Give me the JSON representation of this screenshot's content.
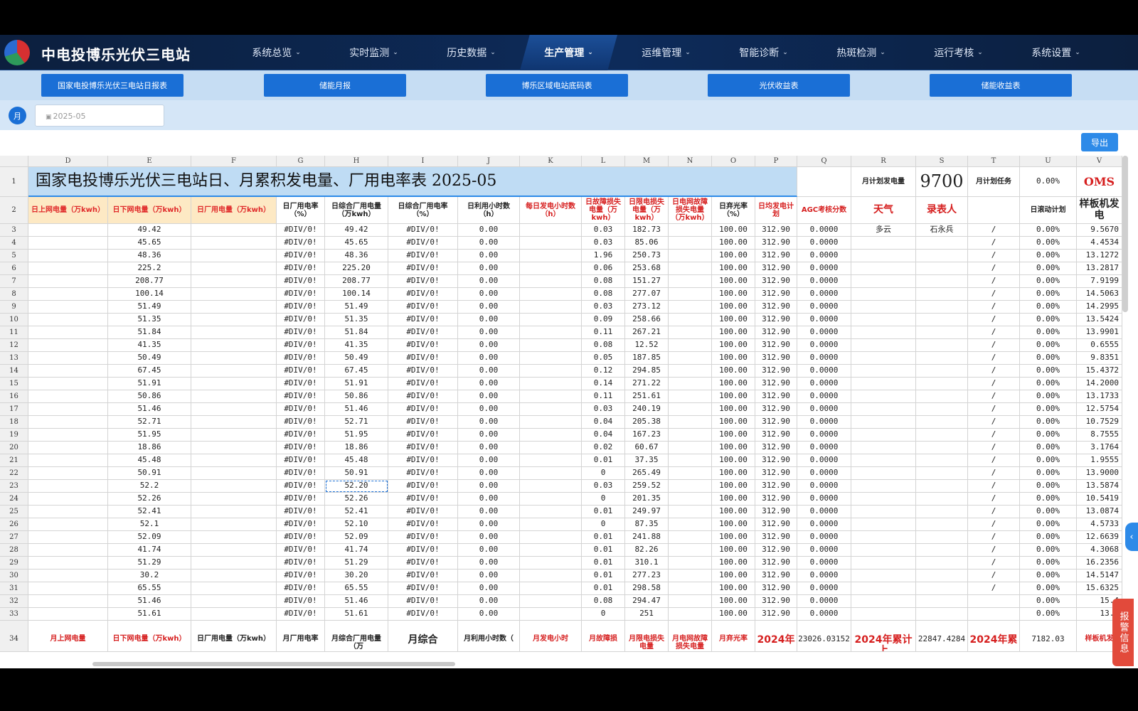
{
  "app": {
    "title": "中电投博乐光伏三电站"
  },
  "nav": {
    "items": [
      "系统总览",
      "实时监测",
      "历史数据",
      "生产管理",
      "运维管理",
      "智能诊断",
      "热斑检测",
      "运行考核",
      "系统设置"
    ],
    "active": "生产管理"
  },
  "report_tabs": [
    "国家电投博乐光伏三电站日报表",
    "储能月报",
    "博乐区域电站底码表",
    "光伏收益表",
    "储能收益表"
  ],
  "filter": {
    "month_badge": "月",
    "date_value": "2025-05"
  },
  "toolbar": {
    "export_label": "导出"
  },
  "sheet": {
    "columns": [
      "D",
      "E",
      "F",
      "G",
      "H",
      "I",
      "J",
      "K",
      "L",
      "M",
      "N",
      "O",
      "P",
      "Q",
      "R",
      "S",
      "T",
      "U",
      "V"
    ],
    "title": "国家电投博乐光伏三电站日、月累积发电量、厂用电率表 2025-05",
    "row1_right": {
      "label_r": "月计划发电量",
      "value_s": "9700",
      "label_t": "月计划任务",
      "value_u": "0.00%",
      "value_v": "OMS"
    },
    "header_row": [
      "日上网电量（万kwh）",
      "日下网电量（万kwh）",
      "日厂用电量（万kwh）",
      "日厂用电率（%）",
      "日综合厂用电量（万kwh）",
      "日综合厂用电率（%）",
      "日利用小时数（h）",
      "每日发电小时数（h）",
      "日故障损失电量（万kwh）",
      "日限电损失电量（万kwh）",
      "日电网故障损失电量（万kwh）",
      "日弃光率（%）",
      "日均发电计划",
      "AGC考核分数",
      "天气",
      "录表人",
      "",
      "日滚动计划",
      "样板机发电"
    ],
    "row_numbers": [
      "3",
      "4",
      "5",
      "6",
      "7",
      "8",
      "9",
      "10",
      "11",
      "12",
      "13",
      "14",
      "15",
      "16",
      "17",
      "18",
      "19",
      "20",
      "21",
      "22",
      "23",
      "24",
      "25",
      "26",
      "27",
      "28",
      "29",
      "30",
      "31",
      "32",
      "33"
    ],
    "col_E": [
      "49.42",
      "45.65",
      "48.36",
      "225.2",
      "208.77",
      "100.14",
      "51.49",
      "51.35",
      "51.84",
      "41.35",
      "50.49",
      "67.45",
      "51.91",
      "50.86",
      "51.46",
      "52.71",
      "51.95",
      "18.86",
      "45.48",
      "50.91",
      "52.2",
      "52.26",
      "52.41",
      "52.1",
      "52.09",
      "41.74",
      "51.29",
      "30.2",
      "65.55",
      "51.46",
      "51.61"
    ],
    "col_H": [
      "49.42",
      "45.65",
      "48.36",
      "225.20",
      "208.77",
      "100.14",
      "51.49",
      "51.35",
      "51.84",
      "41.35",
      "50.49",
      "67.45",
      "51.91",
      "50.86",
      "51.46",
      "52.71",
      "51.95",
      "18.86",
      "45.48",
      "50.91",
      "52.20",
      "52.26",
      "52.41",
      "52.10",
      "52.09",
      "41.74",
      "51.29",
      "30.20",
      "65.55",
      "51.46",
      "51.61"
    ],
    "col_L": [
      "0.03",
      "0.03",
      "1.96",
      "0.06",
      "0.08",
      "0.08",
      "0.03",
      "0.09",
      "0.11",
      "0.08",
      "0.05",
      "0.12",
      "0.14",
      "0.11",
      "0.03",
      "0.04",
      "0.04",
      "0.02",
      "0.01",
      "0",
      "0.03",
      "0",
      "0.01",
      "0",
      "0.01",
      "0.01",
      "0.01",
      "0.01",
      "0.01",
      "0.08",
      "0"
    ],
    "col_M": [
      "182.73",
      "85.06",
      "250.73",
      "253.68",
      "151.27",
      "277.07",
      "273.12",
      "258.66",
      "267.21",
      "12.52",
      "187.85",
      "294.85",
      "271.22",
      "251.61",
      "240.19",
      "205.38",
      "167.23",
      "60.67",
      "37.35",
      "265.49",
      "259.52",
      "201.35",
      "249.97",
      "87.35",
      "241.88",
      "82.26",
      "310.1",
      "277.23",
      "298.58",
      "294.47",
      "251"
    ],
    "col_V": [
      "9.5670",
      "4.4534",
      "13.1272",
      "13.2817",
      "7.9199",
      "14.5063",
      "14.2995",
      "13.5424",
      "13.9901",
      "0.6555",
      "9.8351",
      "15.4372",
      "14.2000",
      "13.1733",
      "12.5754",
      "10.7529",
      "8.7555",
      "3.1764",
      "1.9555",
      "13.9000",
      "13.5874",
      "10.5419",
      "13.0874",
      "4.5733",
      "12.6639",
      "4.3068",
      "16.2356",
      "14.5147",
      "15.6325",
      "15.4",
      "13.1"
    ],
    "div_text": "#DIV/0!",
    "zero_text": "0.00",
    "pct_text": "100.00",
    "plan_text": "312.90",
    "agc_text": "0.0000",
    "u_text": "0.00%",
    "slash": "/",
    "weather": "多云",
    "recorder": "石永兵",
    "footer_row": {
      "row_number": "34",
      "D": "月上网电量",
      "E": "日下网电量（万kwh）",
      "F": "日厂用电量（万kwh）",
      "G": "月厂用电率",
      "H": "月综合厂用电量（万",
      "I": "月综合",
      "J": "月利用小时数（",
      "K": "月发电小时",
      "L": "月故障损",
      "M": "月限电损失电量",
      "N": "月电网故障损失电量",
      "O": "月弃光率",
      "P": "2024年",
      "Q": "23026.03152",
      "R": "2024年累计上",
      "S": "22847.4284",
      "T": "2024年累",
      "U": "7182.03",
      "V": "样板机发"
    }
  },
  "alert_tab": "报警信息",
  "colors": {
    "accent": "#1a6fd6",
    "header_red": "#d61f1f",
    "title_bg": "#bfdcf4"
  }
}
